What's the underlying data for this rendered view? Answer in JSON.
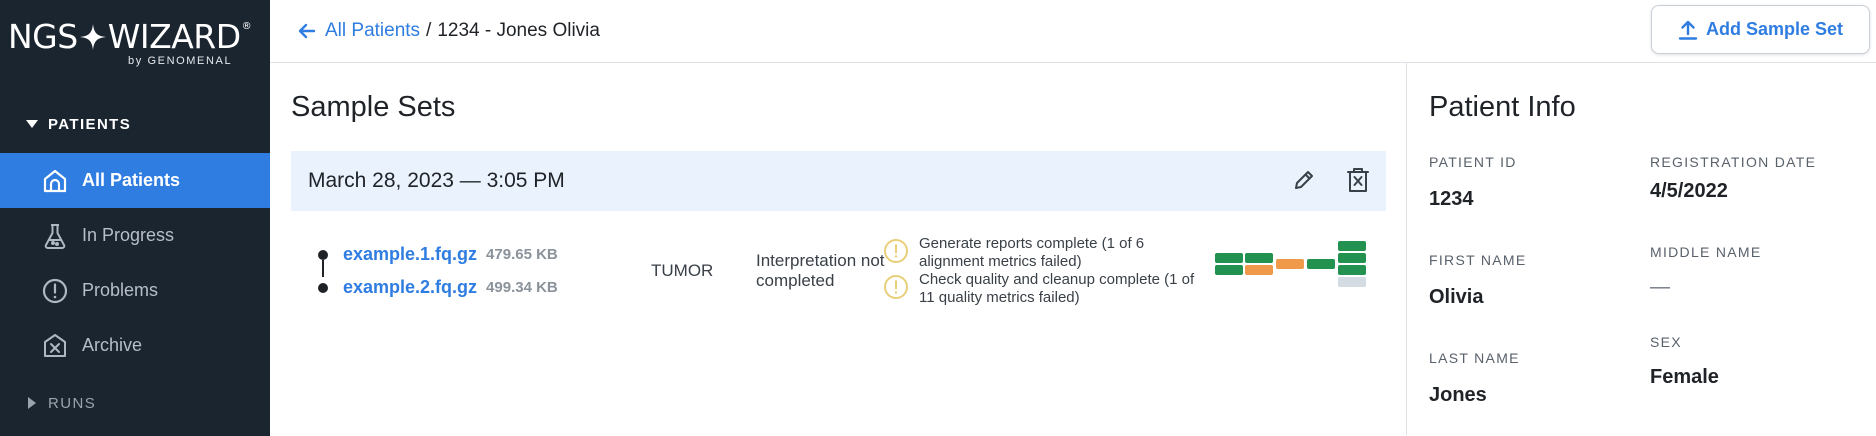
{
  "brand": {
    "name_left": "NGS",
    "name_right": "WIZARD",
    "reg_mark": "®",
    "sub": "by GENOMENAL"
  },
  "sidebar": {
    "section_label": "PATIENTS",
    "items": [
      {
        "label": "All Patients",
        "icon": "home-icon",
        "active": true
      },
      {
        "label": "In Progress",
        "icon": "flask-icon",
        "active": false
      },
      {
        "label": "Problems",
        "icon": "alert-circle-icon",
        "active": false
      },
      {
        "label": "Archive",
        "icon": "archive-x-icon",
        "active": false
      }
    ],
    "runs_label": "RUNS"
  },
  "header": {
    "back_label": "All Patients",
    "separator": "/",
    "current": "1234 - Jones Olivia",
    "add_button_label": "Add Sample Set"
  },
  "sample_sets": {
    "title": "Sample Sets",
    "sets": [
      {
        "datetime": "March 28, 2023 — 3:05 PM",
        "files": [
          {
            "name": "example.1.fq.gz",
            "size": "479.65 KB"
          },
          {
            "name": "example.2.fq.gz",
            "size": "499.34 KB"
          }
        ],
        "sample_type": "TUMOR",
        "interpretation": "Interpretation not completed",
        "warnings": [
          "Generate reports complete (1 of 6 alignment metrics failed)",
          "Check quality and cleanup complete (1 of 11 quality metrics failed)"
        ]
      }
    ]
  },
  "patient_info": {
    "title": "Patient Info",
    "fields": {
      "patient_id": {
        "label": "PATIENT ID",
        "value": "1234"
      },
      "registration_date": {
        "label": "REGISTRATION DATE",
        "value": "4/5/2022"
      },
      "first_name": {
        "label": "FIRST NAME",
        "value": "Olivia"
      },
      "middle_name": {
        "label": "MIDDLE NAME",
        "value": "—"
      },
      "last_name": {
        "label": "LAST NAME",
        "value": "Jones"
      },
      "sex": {
        "label": "SEX",
        "value": "Female"
      }
    }
  },
  "colors": {
    "sidebar_bg": "#1b2530",
    "accent": "#2f7de1",
    "qc_pass": "#23914f",
    "qc_warn": "#ef9a4a",
    "qc_empty": "#d5dbe2",
    "warning_icon": "#e9cf79"
  }
}
